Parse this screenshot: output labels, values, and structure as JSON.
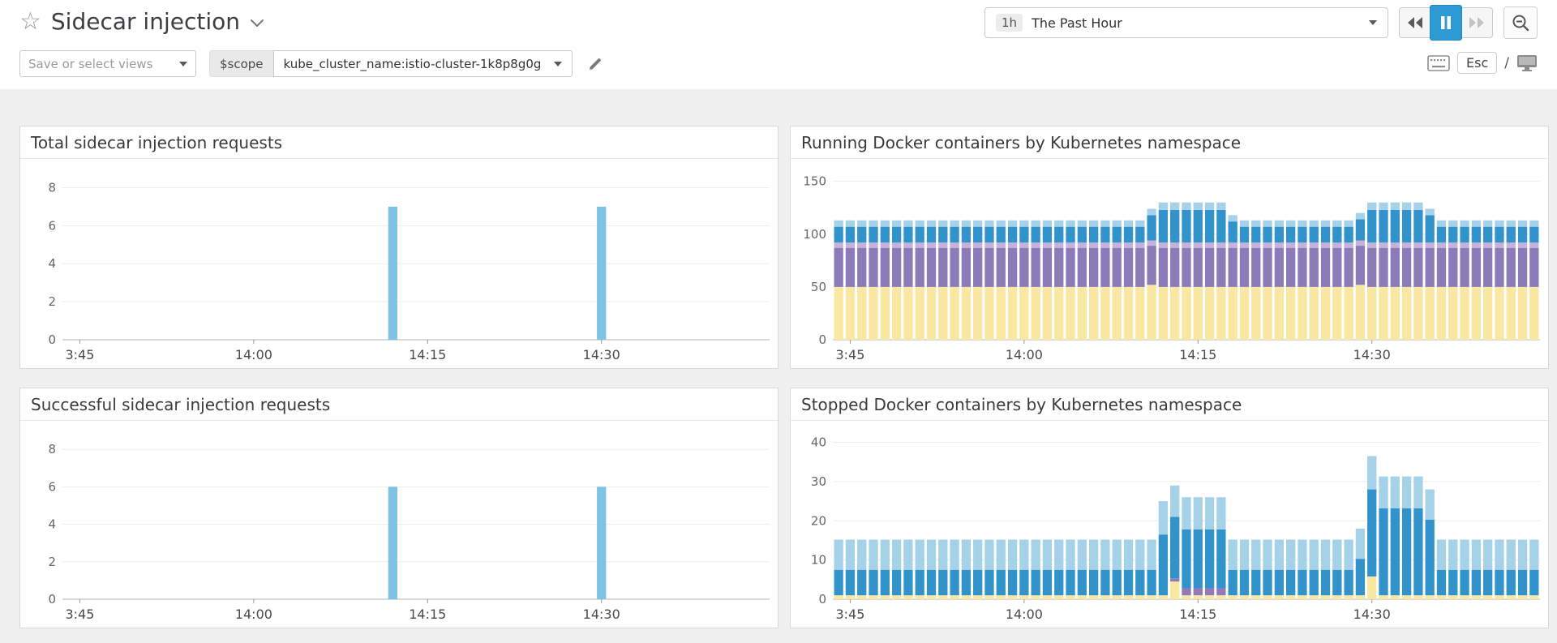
{
  "header": {
    "title": "Sidecar injection",
    "time_range": {
      "badge": "1h",
      "label": "The Past Hour"
    }
  },
  "toolbar": {
    "views_placeholder": "Save or select views",
    "scope_label": "$scope",
    "scope_value": "kube_cluster_name:istio-cluster-1k8p8g0g",
    "esc_key": "Esc",
    "slash": "/"
  },
  "icons": {
    "star": "☆",
    "caret_down": "▾"
  },
  "colors": {
    "accent_blue": "#2E9BD6",
    "page_bg": "#F0F0F1",
    "panel_border": "#D9D9D9",
    "bar_light_blue": "#7EC3E4",
    "stack_yellow": "#F9E8A2",
    "stack_purple": "#8B7BB8",
    "stack_lavender": "#C6B1D9",
    "stack_blue": "#3293CC",
    "stack_pale_blue": "#A6D2E9"
  },
  "chart_data": [
    {
      "id": "total-sidecar-injection-requests",
      "type": "bar",
      "title": "Total sidecar injection requests",
      "ylim": [
        0,
        9
      ],
      "yticks": [
        0,
        2,
        4,
        6,
        8
      ],
      "slots": 61,
      "x_start": "13:44",
      "x_ticks": [
        {
          "label": "3:45",
          "slot": 1
        },
        {
          "label": "14:00",
          "slot": 16
        },
        {
          "label": "14:15",
          "slot": 31
        },
        {
          "label": "14:30",
          "slot": 46
        }
      ],
      "series": [
        {
          "name": "requests",
          "color": "#7EC3E4",
          "values": [
            0,
            0,
            0,
            0,
            0,
            0,
            0,
            0,
            0,
            0,
            0,
            0,
            0,
            0,
            0,
            0,
            0,
            0,
            0,
            0,
            0,
            0,
            0,
            0,
            0,
            0,
            0,
            0,
            7,
            0,
            0,
            0,
            0,
            0,
            0,
            0,
            0,
            0,
            0,
            0,
            0,
            0,
            0,
            0,
            0,
            0,
            7,
            0,
            0,
            0,
            0,
            0,
            0,
            0,
            0,
            0,
            0,
            0,
            0,
            0,
            0
          ]
        }
      ]
    },
    {
      "id": "running-docker-containers",
      "type": "bar",
      "stacked": true,
      "title": "Running Docker containers by Kubernetes namespace",
      "ylim": [
        0,
        162
      ],
      "yticks": [
        0,
        50,
        100,
        150
      ],
      "slots": 61,
      "x_start": "13:44",
      "x_ticks": [
        {
          "label": "3:45",
          "slot": 1
        },
        {
          "label": "14:00",
          "slot": 16
        },
        {
          "label": "14:15",
          "slot": 31
        },
        {
          "label": "14:30",
          "slot": 46
        }
      ],
      "series": [
        {
          "name": "stack-1",
          "color": "#F9E8A2",
          "values": [
            50,
            50,
            50,
            50,
            50,
            50,
            50,
            50,
            50,
            50,
            50,
            50,
            50,
            50,
            50,
            50,
            50,
            50,
            50,
            50,
            50,
            50,
            50,
            50,
            50,
            50,
            50,
            52,
            50,
            50,
            50,
            50,
            50,
            50,
            50,
            50,
            50,
            50,
            50,
            50,
            50,
            50,
            50,
            50,
            50,
            52,
            50,
            50,
            50,
            50,
            50,
            50,
            50,
            50,
            50,
            50,
            50,
            50,
            50,
            50,
            50
          ]
        },
        {
          "name": "stack-2",
          "color": "#8B7BB8",
          "values": [
            37,
            37,
            37,
            37,
            37,
            37,
            37,
            37,
            37,
            37,
            37,
            37,
            37,
            37,
            37,
            37,
            37,
            37,
            37,
            37,
            37,
            37,
            37,
            37,
            37,
            37,
            37,
            37,
            37,
            37,
            37,
            37,
            37,
            37,
            37,
            37,
            37,
            37,
            37,
            37,
            37,
            37,
            37,
            37,
            37,
            37,
            37,
            37,
            37,
            37,
            37,
            37,
            37,
            37,
            37,
            37,
            37,
            37,
            37,
            37,
            37
          ]
        },
        {
          "name": "stack-3",
          "color": "#C6B1D9",
          "values": [
            5,
            5,
            5,
            5,
            5,
            5,
            5,
            5,
            5,
            5,
            5,
            5,
            5,
            5,
            5,
            5,
            5,
            5,
            5,
            5,
            5,
            5,
            5,
            5,
            5,
            5,
            5,
            5,
            5,
            5,
            5,
            5,
            5,
            5,
            5,
            5,
            5,
            5,
            5,
            5,
            5,
            5,
            5,
            5,
            5,
            5,
            5,
            5,
            5,
            5,
            5,
            5,
            5,
            5,
            5,
            5,
            5,
            5,
            5,
            5,
            5
          ]
        },
        {
          "name": "stack-4",
          "color": "#3293CC",
          "values": [
            15,
            15,
            15,
            15,
            15,
            15,
            15,
            15,
            15,
            15,
            15,
            15,
            15,
            15,
            15,
            15,
            15,
            15,
            15,
            15,
            15,
            15,
            15,
            15,
            15,
            15,
            15,
            24,
            31,
            31,
            31,
            31,
            31,
            31,
            20,
            15,
            15,
            15,
            15,
            15,
            15,
            15,
            15,
            15,
            15,
            20,
            31,
            31,
            31,
            31,
            31,
            26,
            15,
            15,
            15,
            15,
            15,
            15,
            15,
            15,
            15
          ]
        },
        {
          "name": "stack-5",
          "color": "#A6D2E9",
          "values": [
            6,
            6,
            6,
            6,
            6,
            6,
            6,
            6,
            6,
            6,
            6,
            6,
            6,
            6,
            6,
            6,
            6,
            6,
            6,
            6,
            6,
            6,
            6,
            6,
            6,
            6,
            6,
            6,
            7,
            7,
            7,
            7,
            7,
            7,
            6,
            6,
            6,
            6,
            6,
            6,
            6,
            6,
            6,
            6,
            6,
            6,
            7,
            7,
            7,
            7,
            7,
            6,
            6,
            6,
            6,
            6,
            6,
            6,
            6,
            6,
            6
          ]
        }
      ]
    },
    {
      "id": "successful-sidecar-injection-requests",
      "type": "bar",
      "title": "Successful sidecar injection requests",
      "ylim": [
        0,
        9
      ],
      "yticks": [
        0,
        2,
        4,
        6,
        8
      ],
      "slots": 61,
      "x_start": "13:44",
      "x_ticks": [
        {
          "label": "3:45",
          "slot": 1
        },
        {
          "label": "14:00",
          "slot": 16
        },
        {
          "label": "14:15",
          "slot": 31
        },
        {
          "label": "14:30",
          "slot": 46
        }
      ],
      "series": [
        {
          "name": "requests",
          "color": "#7EC3E4",
          "values": [
            0,
            0,
            0,
            0,
            0,
            0,
            0,
            0,
            0,
            0,
            0,
            0,
            0,
            0,
            0,
            0,
            0,
            0,
            0,
            0,
            0,
            0,
            0,
            0,
            0,
            0,
            0,
            0,
            6,
            0,
            0,
            0,
            0,
            0,
            0,
            0,
            0,
            0,
            0,
            0,
            0,
            0,
            0,
            0,
            0,
            0,
            6,
            0,
            0,
            0,
            0,
            0,
            0,
            0,
            0,
            0,
            0,
            0,
            0,
            0,
            0
          ]
        }
      ]
    },
    {
      "id": "stopped-docker-containers",
      "type": "bar",
      "stacked": true,
      "title": "Stopped Docker containers by Kubernetes namespace",
      "ylim": [
        0,
        43
      ],
      "yticks": [
        0,
        10,
        20,
        30,
        40
      ],
      "slots": 61,
      "x_start": "13:44",
      "x_ticks": [
        {
          "label": "3:45",
          "slot": 1
        },
        {
          "label": "14:00",
          "slot": 16
        },
        {
          "label": "14:15",
          "slot": 31
        },
        {
          "label": "14:30",
          "slot": 46
        }
      ],
      "series": [
        {
          "name": "stack-1",
          "color": "#F9E8A2",
          "values": [
            1,
            1,
            1,
            1,
            1,
            1,
            1,
            1,
            1,
            1,
            1,
            1,
            1,
            1,
            1,
            1,
            1,
            1,
            1,
            1,
            1,
            1,
            1,
            1,
            1,
            1,
            1,
            1,
            1,
            4.5,
            1,
            1,
            1,
            1,
            1,
            1,
            1,
            1,
            1,
            1,
            1,
            1,
            1,
            1,
            1,
            1,
            5.8,
            1,
            1,
            1,
            1,
            1,
            1,
            1,
            1,
            1,
            1,
            1,
            1,
            1,
            1
          ]
        },
        {
          "name": "stack-2",
          "color": "#9379B8",
          "values": [
            0,
            0,
            0,
            0,
            0,
            0,
            0,
            0,
            0,
            0,
            0,
            0,
            0,
            0,
            0,
            0,
            0,
            0,
            0,
            0,
            0,
            0,
            0,
            0,
            0,
            0,
            0,
            0,
            0,
            0.8,
            1.8,
            1.8,
            1.8,
            1.8,
            0,
            0,
            0,
            0,
            0,
            0,
            0,
            0,
            0,
            0,
            0,
            0,
            0,
            0,
            0,
            0,
            0,
            0,
            0,
            0,
            0,
            0,
            0,
            0,
            0,
            0,
            0
          ]
        },
        {
          "name": "stack-3",
          "color": "#3293CC",
          "values": [
            6.5,
            6.5,
            6.5,
            6.5,
            6.5,
            6.5,
            6.5,
            6.5,
            6.5,
            6.5,
            6.5,
            6.5,
            6.5,
            6.5,
            6.5,
            6.5,
            6.5,
            6.5,
            6.5,
            6.5,
            6.5,
            6.5,
            6.5,
            6.5,
            6.5,
            6.5,
            6.5,
            6.5,
            15.5,
            15.7,
            15,
            15,
            15,
            15,
            6.5,
            6.5,
            6.5,
            6.5,
            6.5,
            6.5,
            6.5,
            6.5,
            6.5,
            6.5,
            6.5,
            9.3,
            22.2,
            22.2,
            22.2,
            22.2,
            22.2,
            19.3,
            6.5,
            6.5,
            6.5,
            6.5,
            6.5,
            6.5,
            6.5,
            6.5,
            6.5
          ]
        },
        {
          "name": "stack-4",
          "color": "#A6D2E9",
          "values": [
            7.7,
            7.7,
            7.7,
            7.7,
            7.7,
            7.7,
            7.7,
            7.7,
            7.7,
            7.7,
            7.7,
            7.7,
            7.7,
            7.7,
            7.7,
            7.7,
            7.7,
            7.7,
            7.7,
            7.7,
            7.7,
            7.7,
            7.7,
            7.7,
            7.7,
            7.7,
            7.7,
            7.7,
            8.5,
            8,
            8.2,
            8.2,
            8.2,
            8.2,
            7.7,
            7.7,
            7.7,
            7.7,
            7.7,
            7.7,
            7.7,
            7.7,
            7.7,
            7.7,
            7.7,
            7.7,
            8.5,
            8.1,
            8.1,
            8.1,
            8.1,
            7.7,
            7.7,
            7.7,
            7.7,
            7.7,
            7.7,
            7.7,
            7.7,
            7.7,
            7.7
          ]
        }
      ]
    }
  ]
}
